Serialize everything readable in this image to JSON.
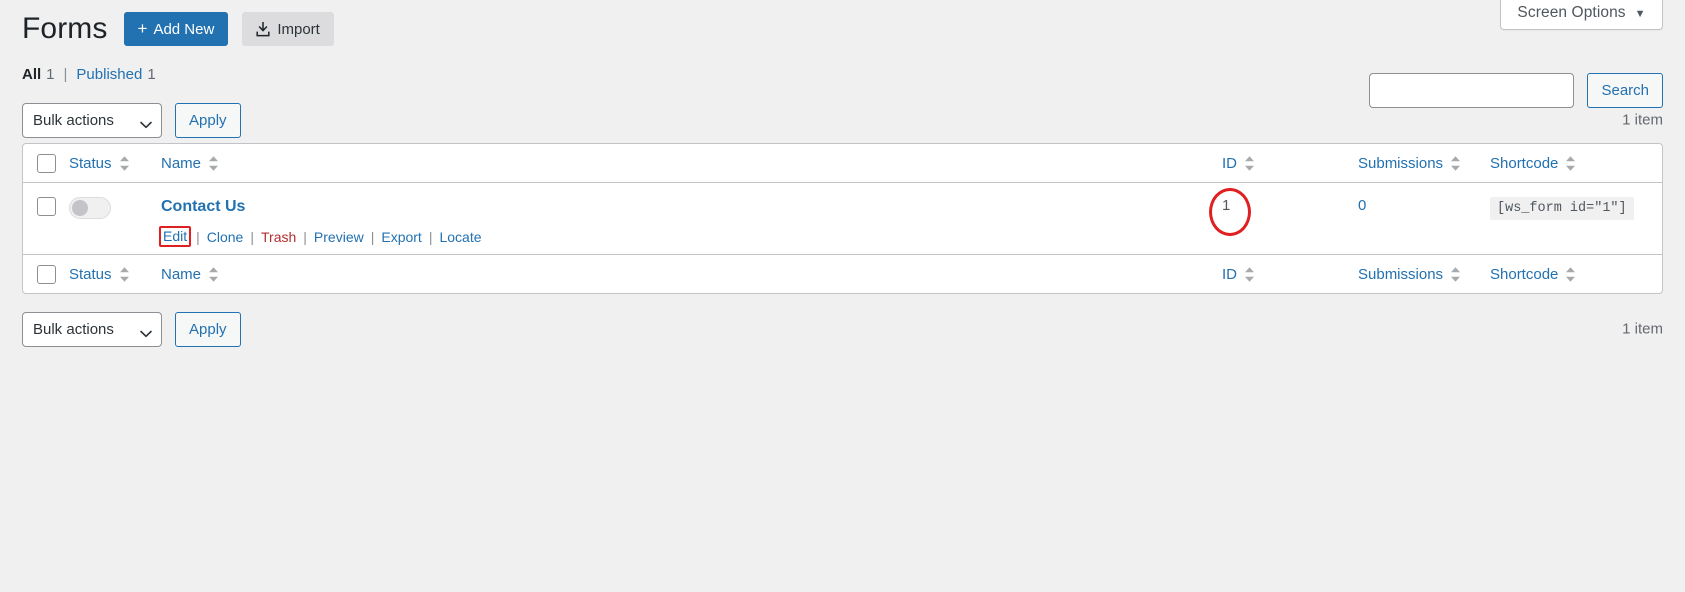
{
  "screen_options": {
    "label": "Screen Options",
    "caret_icon": "chevron-down-icon"
  },
  "header": {
    "title": "Forms",
    "add_new_label": "Add New",
    "add_new_icon": "plus-icon",
    "import_label": "Import",
    "import_icon": "download-import-icon"
  },
  "filters": [
    {
      "label": "All",
      "count": "1",
      "current": true
    },
    {
      "label": "Published",
      "count": "1",
      "current": false
    }
  ],
  "filter_separator": "|",
  "search": {
    "value": "",
    "placeholder": "",
    "button_label": "Search"
  },
  "tablenav": {
    "bulk_actions_label": "Bulk actions",
    "bulk_actions_options": [
      "Bulk actions"
    ],
    "apply_label": "Apply",
    "displaying_num": "1 item",
    "chevron_icon": "chevron-down-icon"
  },
  "table": {
    "columns": [
      {
        "key": "cb",
        "label": "",
        "sortable": false
      },
      {
        "key": "status",
        "label": "Status",
        "sortable": true
      },
      {
        "key": "name",
        "label": "Name",
        "sortable": true
      },
      {
        "key": "spacer",
        "label": "",
        "sortable": false
      },
      {
        "key": "id",
        "label": "ID",
        "sortable": true
      },
      {
        "key": "subs",
        "label": "Submissions",
        "sortable": true
      },
      {
        "key": "short",
        "label": "Shortcode",
        "sortable": true
      }
    ],
    "sort_icon": "sort-updown-icon",
    "rows": [
      {
        "status_toggle": "off",
        "name": "Contact Us",
        "actions": [
          {
            "label": "Edit",
            "style": "link",
            "highlighted": true
          },
          {
            "label": "Clone",
            "style": "link",
            "highlighted": false
          },
          {
            "label": "Trash",
            "style": "trash",
            "highlighted": false
          },
          {
            "label": "Preview",
            "style": "link",
            "highlighted": false
          },
          {
            "label": "Export",
            "style": "link",
            "highlighted": false
          },
          {
            "label": "Locate",
            "style": "link",
            "highlighted": false
          }
        ],
        "action_separator": "|",
        "id": "1",
        "id_annotated": true,
        "submissions": "0",
        "shortcode": "[ws_form id=\"1\"]"
      }
    ]
  },
  "annotations": {
    "color": "#e02020",
    "ellipse_target": "id-value",
    "box_target": "edit-action-link"
  }
}
